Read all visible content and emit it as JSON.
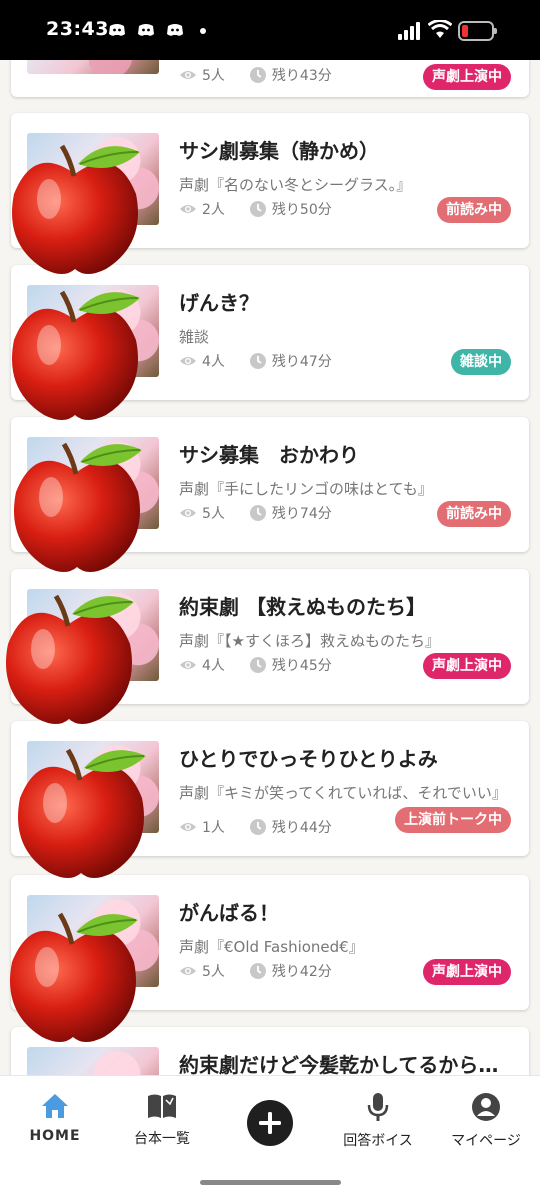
{
  "status_bar": {
    "time": "23:43",
    "battery_level": 0.15
  },
  "rooms": [
    {
      "title": "",
      "subtitle": "",
      "listeners": "5人",
      "remaining": "残り43分",
      "badge": "声劇上演中",
      "badge_color": "#e0266b"
    },
    {
      "title": "サシ劇募集（静かめ）",
      "subtitle": "声劇『名のない冬とシーグラス。』",
      "listeners": "2人",
      "remaining": "残り50分",
      "badge": "前読み中",
      "badge_color": "#e26d73"
    },
    {
      "title": "げんき？",
      "subtitle": "雑談",
      "listeners": "4人",
      "remaining": "残り47分",
      "badge": "雑談中",
      "badge_color": "#3fb5a8"
    },
    {
      "title": "サシ募集　おかわり",
      "subtitle": "声劇『手にしたリンゴの味はとても』",
      "listeners": "5人",
      "remaining": "残り74分",
      "badge": "前読み中",
      "badge_color": "#e26d73"
    },
    {
      "title": "約束劇 【救えぬものたち】",
      "subtitle": "声劇『【★すくほろ】救えぬものたち』",
      "listeners": "4人",
      "remaining": "残り45分",
      "badge": "声劇上演中",
      "badge_color": "#e0266b"
    },
    {
      "title": "ひとりでひっそりひとりよみ",
      "subtitle": "声劇『キミが笑ってくれていれば、それでいい』",
      "listeners": "1人",
      "remaining": "残り44分",
      "badge": "上演前トーク中",
      "badge_color": "#e26d73"
    },
    {
      "title": "がんばる！",
      "subtitle": "声劇『€Old Fashioned€』",
      "listeners": "5人",
      "remaining": "残り42分",
      "badge": "声劇上演中",
      "badge_color": "#e0266b"
    },
    {
      "title": "約束劇だけど今髪乾かしてるから…",
      "subtitle": "",
      "listeners": "",
      "remaining": "",
      "badge": "",
      "badge_color": "#e0266b"
    }
  ],
  "bottom_nav": {
    "items": [
      {
        "label": "HOME",
        "icon": "home-icon",
        "active": true
      },
      {
        "label": "台本一覧",
        "icon": "book-icon",
        "active": false
      },
      {
        "label": "",
        "icon": "plus-icon",
        "active": false
      },
      {
        "label": "回答ボイス",
        "icon": "mic-icon",
        "active": false
      },
      {
        "label": "マイページ",
        "icon": "account-icon",
        "active": false
      }
    ]
  },
  "colors": {
    "accent_home": "#4a9be0",
    "badge_pink": "#e0266b",
    "badge_salmon": "#e26d73",
    "badge_teal": "#3fb5a8"
  }
}
